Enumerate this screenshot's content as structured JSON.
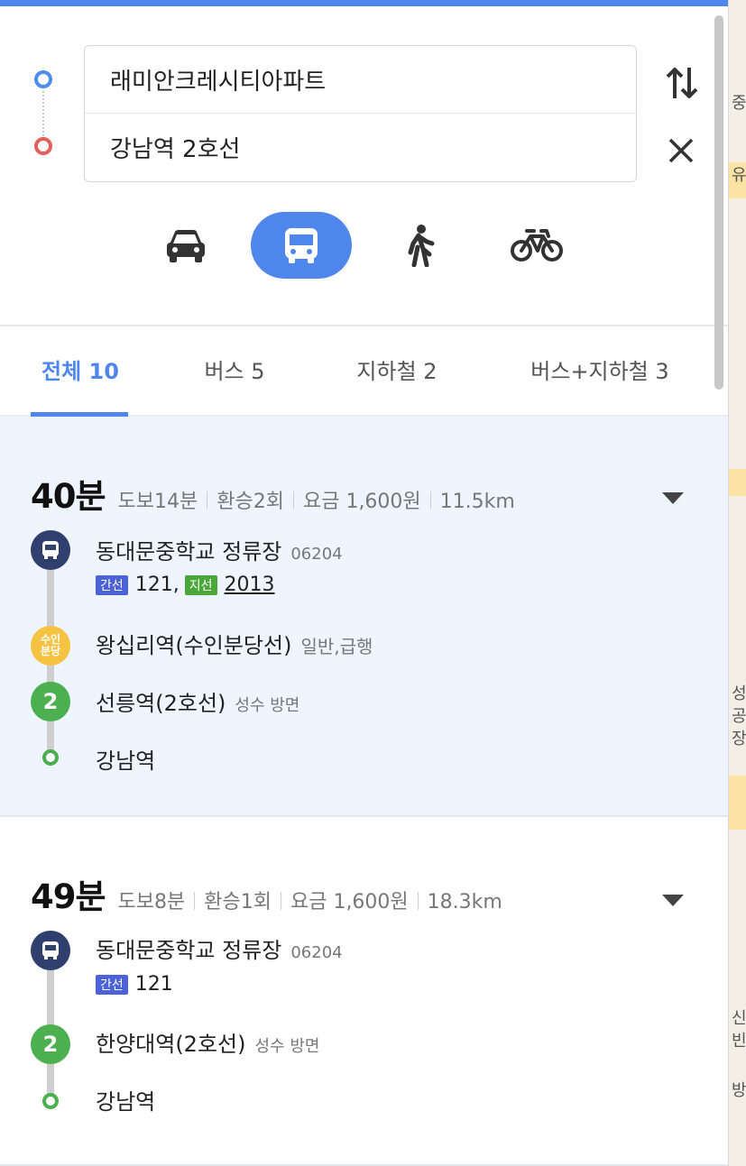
{
  "search": {
    "origin_value": "래미안크레시티아파트",
    "destination_value": "강남역 2호선"
  },
  "modes": {
    "selected": "transit",
    "items": [
      "car-icon",
      "bus-icon",
      "walk-icon",
      "bike-icon"
    ],
    "accent": "#4f86ec"
  },
  "tabs": [
    {
      "label": "전체 10",
      "active": true
    },
    {
      "label": "버스 5",
      "active": false
    },
    {
      "label": "지하철 2",
      "active": false
    },
    {
      "label": "버스+지하철 3",
      "active": false
    }
  ],
  "routes": [
    {
      "time": "40분",
      "walk": "도보14분",
      "transfer": "환승2회",
      "fare": "요금 1,600원",
      "distance": "11.5km",
      "stops": [
        {
          "type": "bus",
          "name": "동대문중학교 정류장",
          "code": "06204"
        },
        {
          "type": "suin",
          "icon_text": "수인분당",
          "name": "왕십리역(수인분당선)",
          "note": "일반,급행"
        },
        {
          "type": "line2",
          "icon_text": "2",
          "name": "선릉역(2호선)",
          "note": "성수 방면"
        },
        {
          "type": "end",
          "name": "강남역"
        }
      ],
      "bus_lines": [
        {
          "badge": "간선",
          "number": "121,"
        },
        {
          "badge": "지선",
          "number": "2013"
        }
      ]
    },
    {
      "time": "49분",
      "walk": "도보8분",
      "transfer": "환승1회",
      "fare": "요금 1,600원",
      "distance": "18.3km",
      "stops": [
        {
          "type": "bus",
          "name": "동대문중학교 정류장",
          "code": "06204"
        },
        {
          "type": "line2",
          "icon_text": "2",
          "name": "한양대역(2호선)",
          "note": "성수 방면"
        },
        {
          "type": "end",
          "name": "강남역"
        }
      ],
      "bus_lines": [
        {
          "badge": "간선",
          "number": "121"
        }
      ]
    }
  ],
  "map_fragments": [
    "중",
    "유",
    "성",
    "공",
    "장",
    "신",
    "빈",
    "방"
  ],
  "colors": {
    "line2": "#4caf50",
    "suin_bundang": "#f5c242",
    "bus_stop": "#2f3f6e",
    "trunk_bus": "#4c62d8",
    "branch_bus": "#4aa83a",
    "origin_pin": "#4c8ef0",
    "destination_pin": "#e5605a"
  }
}
